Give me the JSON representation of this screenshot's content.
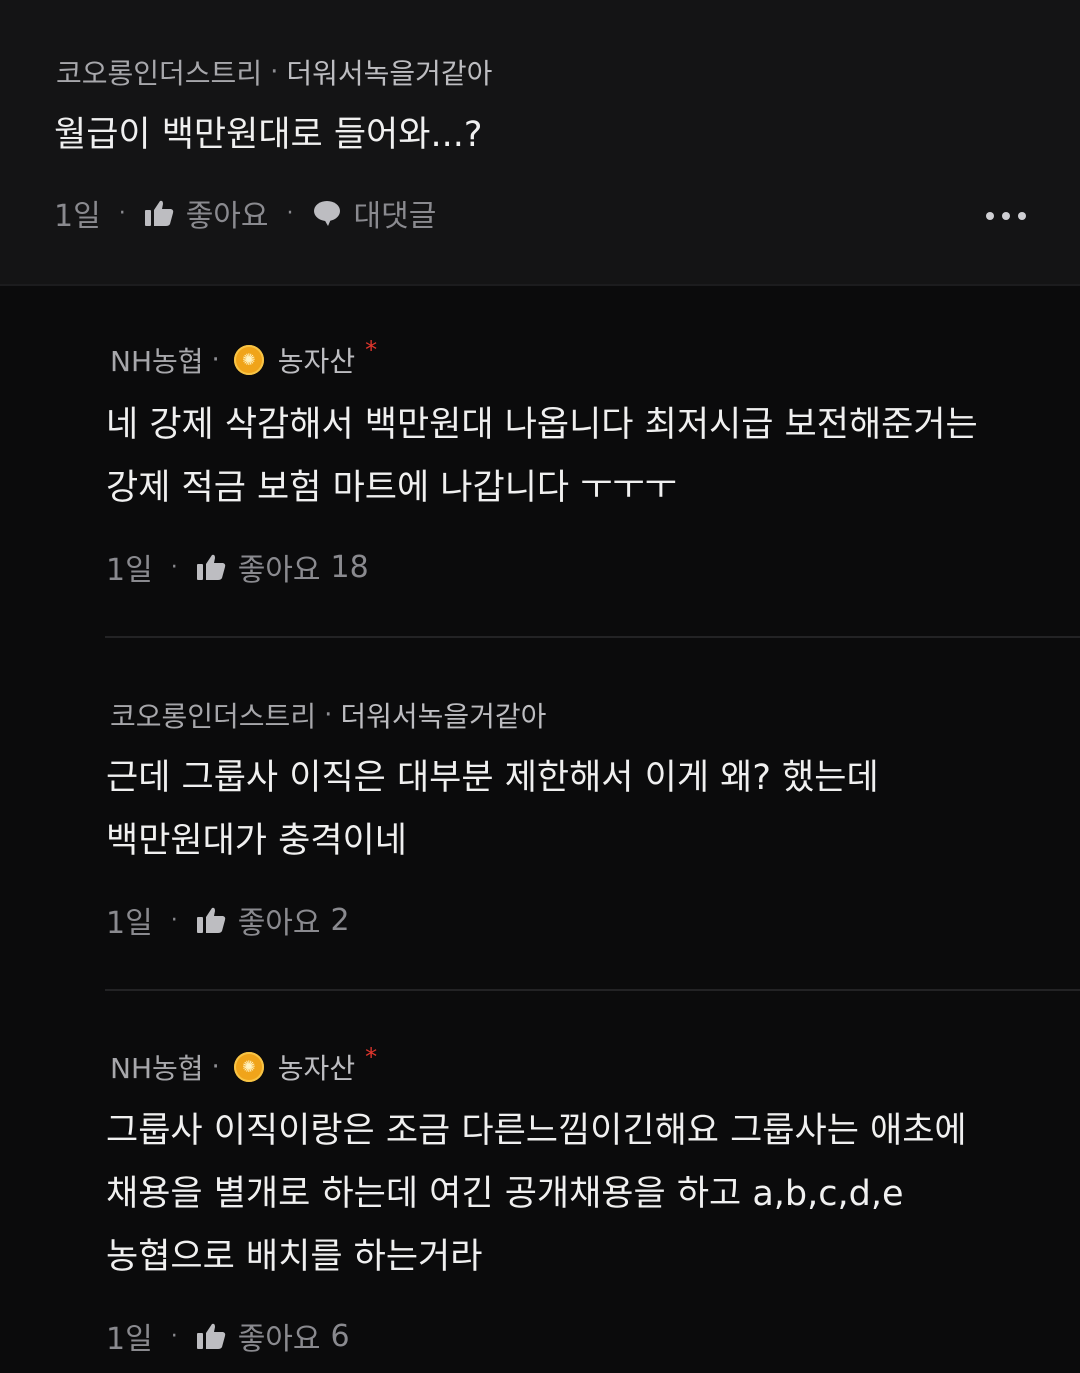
{
  "top_comment": {
    "company": "코오롱인더스트리",
    "nickname": "더워서녹을거같아",
    "text": "월급이 백만원대로 들어와...?",
    "time": "1일",
    "like_label": "좋아요",
    "reply_label": "대댓글"
  },
  "replies": [
    {
      "company": "NH농협",
      "nickname": "농자산",
      "badge_color": "#f0a41a",
      "verified_color": "#e0362d",
      "lines": [
        "네 강제 삭감해서 백만원대 나옵니다 최저시급 보전해준거는",
        "강제 적금 보험 마트에 나갑니다 ㅜㅜㅜ"
      ],
      "time": "1일",
      "like_label": "좋아요",
      "like_count": "18"
    },
    {
      "company": "코오롱인더스트리",
      "nickname": "더워서녹을거같아",
      "lines": [
        "근데 그룹사 이직은 대부분 제한해서 이게 왜? 했는데",
        "백만원대가 충격이네"
      ],
      "time": "1일",
      "like_label": "좋아요",
      "like_count": "2"
    },
    {
      "company": "NH농협",
      "nickname": "농자산",
      "badge_color": "#f0a41a",
      "verified_color": "#e0362d",
      "lines": [
        "그룹사 이직이랑은 조금 다른느낌이긴해요 그룹사는 애초에",
        "채용을 별개로 하는데 여긴 공개채용을 하고 a,b,c,d,e",
        "농협으로 배치를 하는거라"
      ],
      "time": "1일",
      "like_label": "좋아요",
      "like_count": "6"
    }
  ],
  "icons": {
    "like": "thumbs-up-icon",
    "reply": "speech-bubble-icon",
    "more": "more-dots-icon",
    "badge": "gold-badge-icon"
  },
  "sep": "·",
  "verified_mark": "*"
}
